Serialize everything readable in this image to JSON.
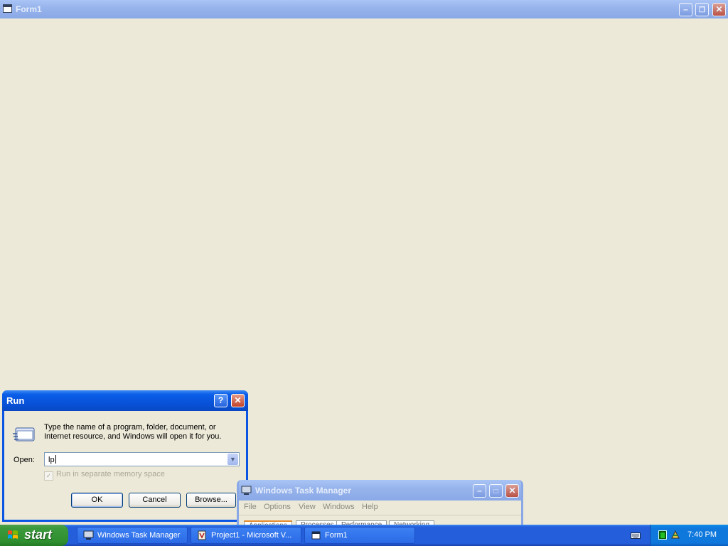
{
  "form1": {
    "title": "Form1"
  },
  "run_dialog": {
    "title": "Run",
    "description": "Type the name of a program, folder, document, or Internet resource, and Windows will open it for you.",
    "open_label": "Open:",
    "open_value": "lp",
    "separate_memory_label": "Run in separate memory space",
    "ok_label": "OK",
    "cancel_label": "Cancel",
    "browse_label": "Browse..."
  },
  "task_manager": {
    "title": "Windows Task Manager",
    "menu": [
      "File",
      "Options",
      "View",
      "Windows",
      "Help"
    ],
    "tabs": [
      "Applications",
      "Processes",
      "Performance",
      "Networking"
    ]
  },
  "taskbar": {
    "start_label": "start",
    "tasks": [
      {
        "label": "Windows Task Manager",
        "icon": "monitor-icon"
      },
      {
        "label": "Project1 - Microsoft V...",
        "icon": "vb-icon"
      },
      {
        "label": "Form1",
        "icon": "window-icon"
      }
    ],
    "clock": "7:40 PM"
  }
}
